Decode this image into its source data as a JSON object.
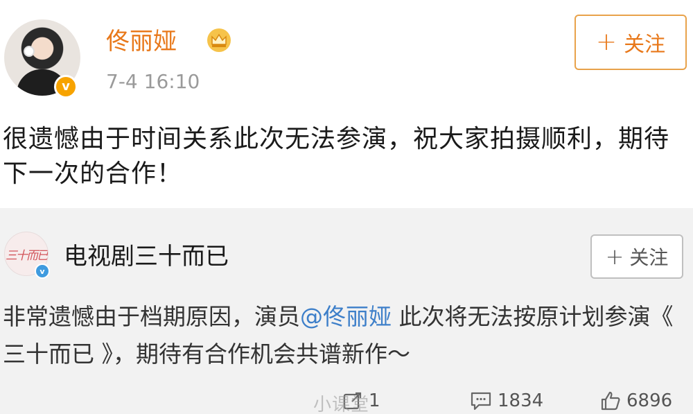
{
  "post": {
    "author": "佟丽娅",
    "verified_badge": "v",
    "member_icon": "crown-icon",
    "time": "7-4 16:10",
    "follow_plus": "+",
    "follow_label": "关注",
    "text": "很遗憾由于时间关系此次无法参演，祝大家拍摄顺利，期待下一次的合作！"
  },
  "repost": {
    "author": "电视剧三十而已",
    "avatar_text": "三十而已",
    "verified_badge": "v",
    "follow_plus": "+",
    "follow_label": "关注",
    "text_before": "非常遗憾由于档期原因，演员",
    "mention": "@佟丽娅",
    "text_after": " 此次将无法按原计划参演《 三十而已 》，期待有合作机会共谱新作～"
  },
  "actions": {
    "repost_count": "1",
    "comment_count": "1834",
    "like_count": "6896"
  },
  "watermark": "小课堂",
  "colors": {
    "username_orange": "#e8781a",
    "follow_border": "#e8a24a",
    "mention_blue": "#3d7fc9",
    "repost_bg": "#f2f2f2",
    "time_gray": "#9a9a9a"
  }
}
